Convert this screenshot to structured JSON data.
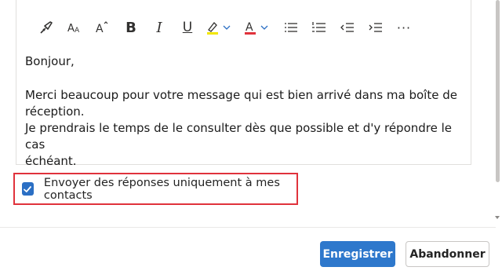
{
  "toolbar": {
    "bold_glyph": "B",
    "italic_glyph": "I",
    "underline_glyph": "U",
    "more_glyph": "···",
    "buttons": [
      "format-painter-icon",
      "font-size-icon",
      "increase-font-icon",
      "bold-icon",
      "italic-icon",
      "underline-icon",
      "highlight-icon",
      "font-color-icon",
      "bullets-icon",
      "numbering-icon",
      "decrease-indent-icon",
      "increase-indent-icon",
      "more-options-icon"
    ],
    "highlight_color": "#f2e600",
    "font_color": "#e0323c"
  },
  "message": {
    "greeting": "Bonjour,",
    "line1": "Merci beaucoup pour votre message qui est bien arrivé dans ma boîte de",
    "line2": "réception.",
    "line3": "Je prendrais le temps de le consulter dès que possible et d'y répondre le cas",
    "line4": "échéant."
  },
  "option": {
    "checked": true,
    "label": "Envoyer des réponses uniquement à mes contacts",
    "highlight_color": "#e0323c"
  },
  "actions": {
    "save_label": "Enregistrer",
    "cancel_label": "Abandonner",
    "accent_color": "#2e78cc"
  }
}
